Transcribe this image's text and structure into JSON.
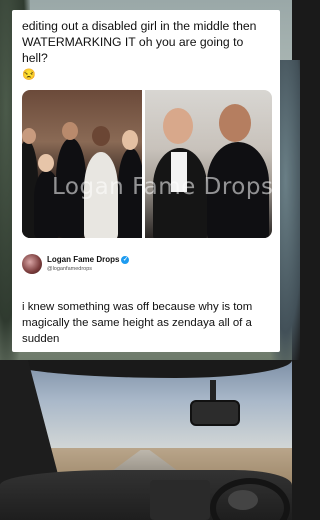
{
  "caption": "editing out a disabled girl in the middle then WATERMARKING IT oh you are going to hell?",
  "caption_emoji": "😒",
  "watermark": "Logan Fame Drops",
  "author": {
    "name": "Logan Fame Drops",
    "handle": "@loganfamedrops",
    "verified_icon": "verified-badge-icon"
  },
  "tweet_text": "i knew something was off because why is tom magically the same height as zendaya all of a sudden",
  "colors": {
    "card_background": "#ffffff",
    "text": "#111111",
    "verified_blue": "#1d9bf0"
  }
}
